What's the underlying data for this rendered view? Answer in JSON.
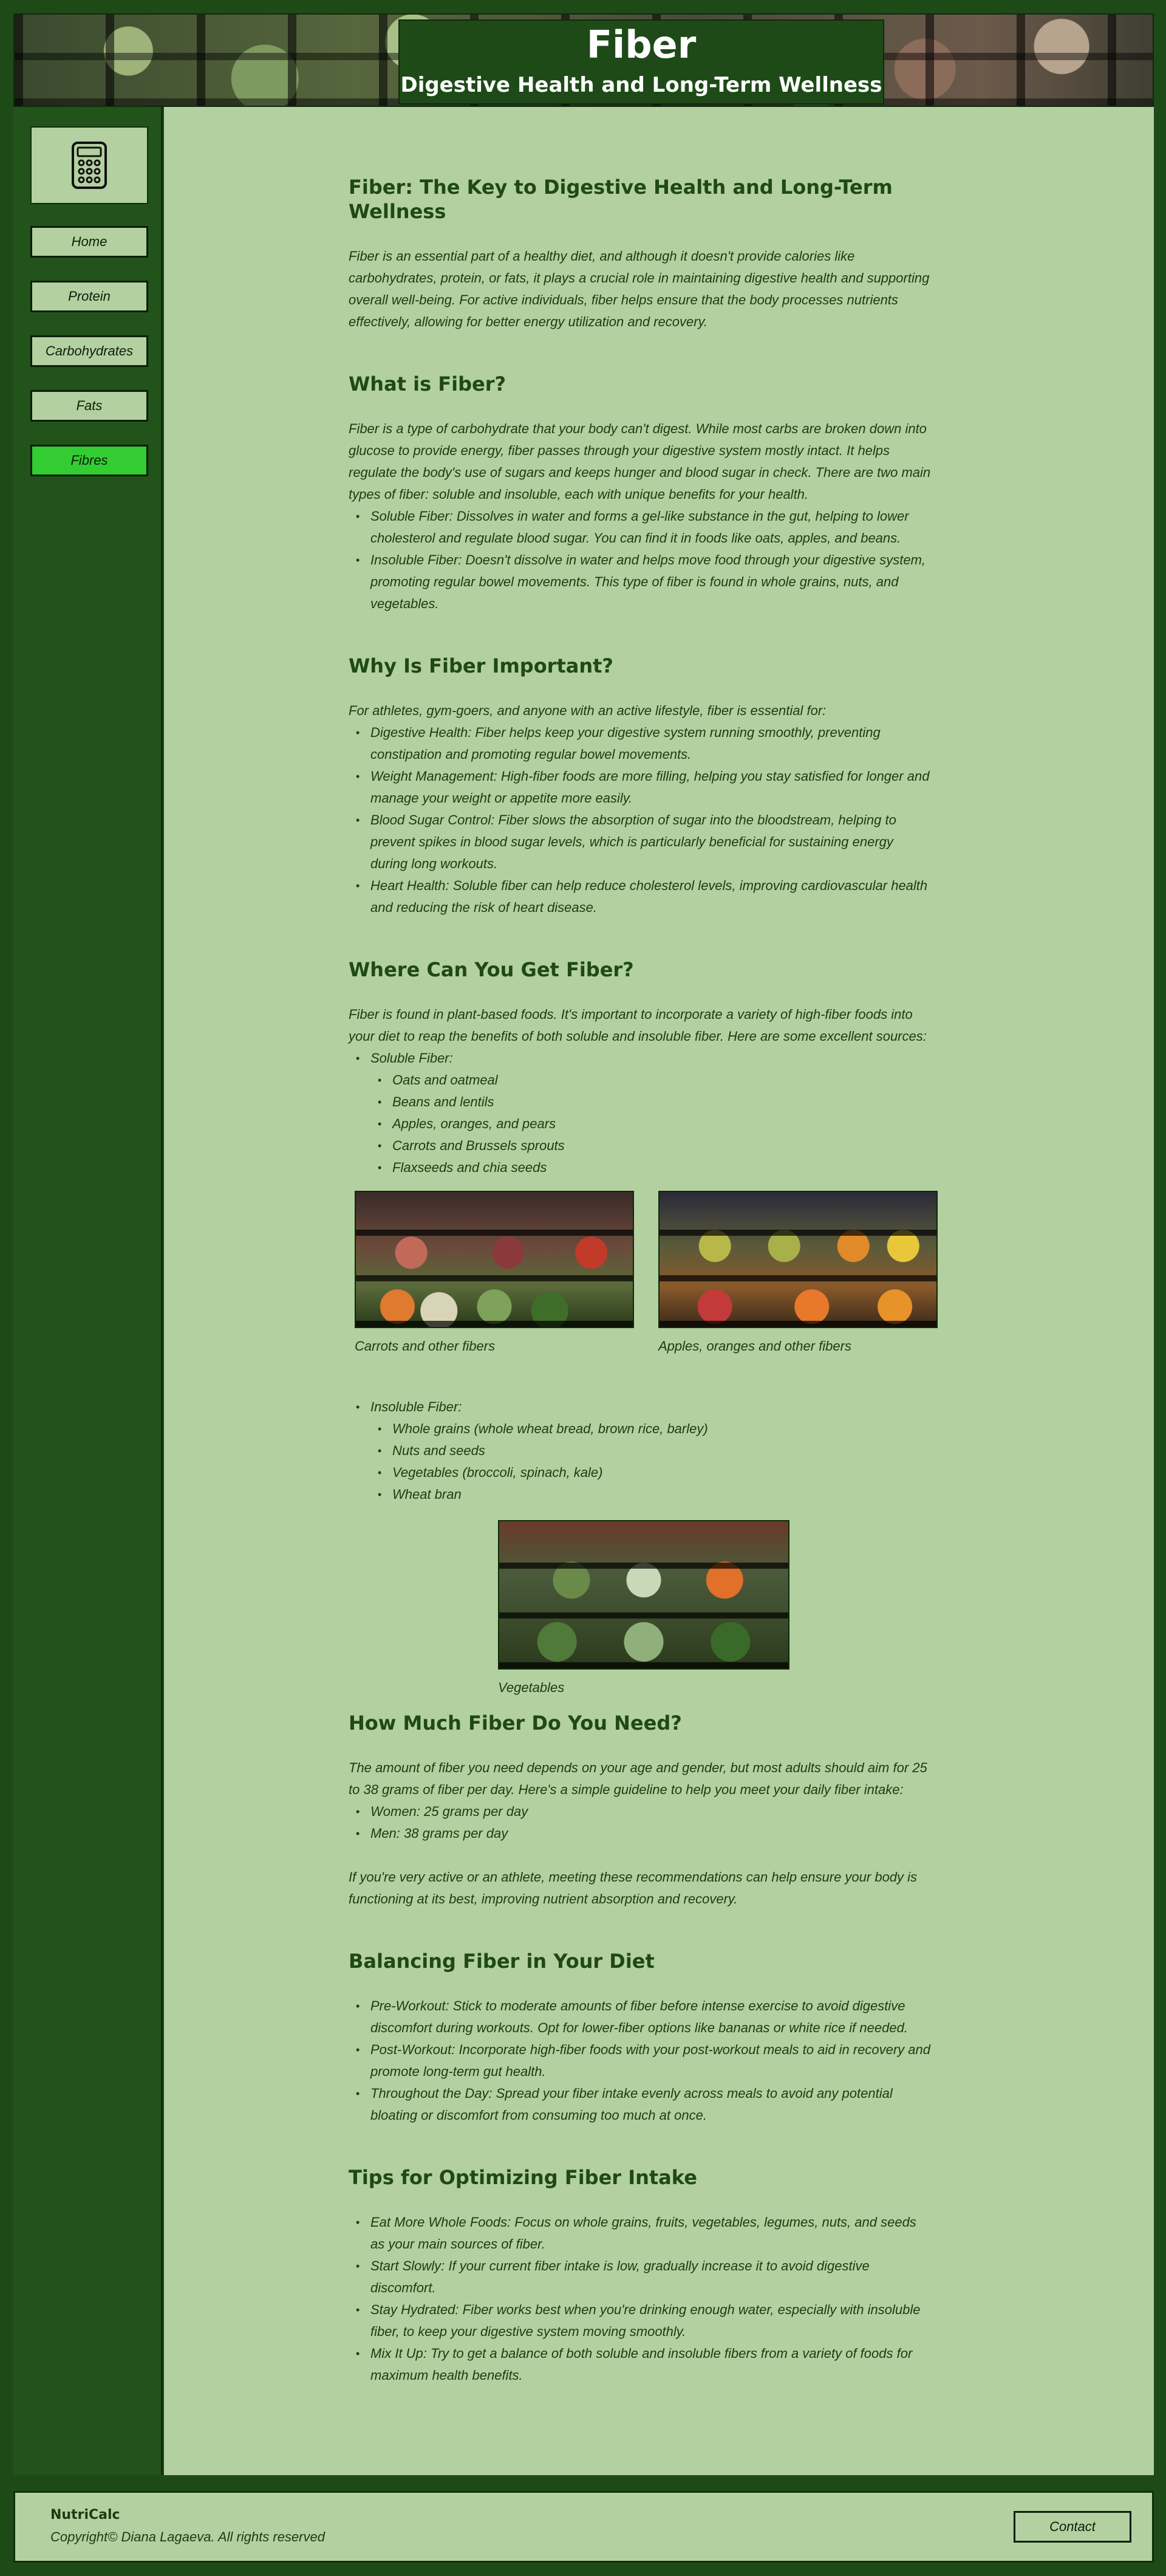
{
  "header": {
    "title": "Fiber",
    "subtitle": "Digestive Health and Long-Term Wellness"
  },
  "sidebar": {
    "logo_icon": "calculator-icon",
    "items": [
      {
        "label": "Home",
        "active": false
      },
      {
        "label": "Protein",
        "active": false
      },
      {
        "label": "Carbohydrates",
        "active": false
      },
      {
        "label": "Fats",
        "active": false
      },
      {
        "label": "Fibres",
        "active": true
      }
    ],
    "active_color": "#33cc33"
  },
  "colors": {
    "page_bg": "#1e4a18",
    "content_bg": "#b3d0a0",
    "heading": "#1f4a12"
  },
  "intro": {
    "heading": "Fiber: The Key to Digestive Health and Long-Term Wellness",
    "text": "Fiber is an essential part of a healthy diet, and although it doesn't provide calories like carbohydrates, protein, or fats, it plays a crucial role in maintaining digestive health and supporting overall well-being. For active individuals, fiber helps ensure that the body processes nutrients effectively, allowing for better energy utilization and recovery."
  },
  "what": {
    "heading": "What is Fiber?",
    "text": "Fiber is a type of carbohydrate that your body can't digest. While most carbs are broken down into glucose to provide energy, fiber passes through your digestive system mostly intact. It helps regulate the body's use of sugars and keeps hunger and blood sugar in check. There are two main types of fiber: soluble and insoluble, each with unique benefits for your health.",
    "items": [
      "Soluble Fiber: Dissolves in water and forms a gel-like substance in the gut, helping to lower cholesterol and regulate blood sugar. You can find it in foods like oats, apples, and beans.",
      "Insoluble Fiber: Doesn't dissolve in water and helps move food through your digestive system, promoting regular bowel movements. This type of fiber is found in whole grains, nuts, and vegetables."
    ]
  },
  "why": {
    "heading": "Why Is Fiber Important?",
    "text": "For athletes, gym-goers, and anyone with an active lifestyle, fiber is essential for:",
    "items": [
      "Digestive Health: Fiber helps keep your digestive system running smoothly, preventing constipation and promoting regular bowel movements.",
      "Weight Management: High-fiber foods are more filling, helping you stay satisfied for longer and manage your weight or appetite more easily.",
      "Blood Sugar Control: Fiber slows the absorption of sugar into the bloodstream, helping to prevent spikes in blood sugar levels, which is particularly beneficial for sustaining energy during long workouts.",
      "Heart Health: Soluble fiber can help reduce cholesterol levels, improving cardiovascular health and reducing the risk of heart disease."
    ]
  },
  "where": {
    "heading": "Where Can You Get Fiber?",
    "text": "Fiber is found in plant-based foods. It's important to incorporate a variety of high-fiber foods into your diet to reap the benefits of both soluble and insoluble fiber. Here are some excellent sources:",
    "soluble_label": "Soluble Fiber:",
    "soluble_items": [
      "Oats and oatmeal",
      "Beans and lentils",
      "Apples, oranges, and pears",
      "Carrots and Brussels sprouts",
      "Flaxseeds and chia seeds"
    ],
    "image1_caption": "Carrots and other fibers",
    "image2_caption": "Apples, oranges and other fibers",
    "insoluble_label": "Insoluble Fiber:",
    "insoluble_items": [
      "Whole grains (whole wheat bread, brown rice, barley)",
      "Nuts and seeds",
      "Vegetables (broccoli, spinach, kale)",
      "Wheat bran"
    ],
    "image3_caption": "Vegetables"
  },
  "how_much": {
    "heading": "How Much Fiber Do You Need?",
    "text": "The amount of fiber you need depends on your age and gender, but most adults should aim for 25 to 38 grams of fiber per day. Here's a simple guideline to help you meet your daily fiber intake:",
    "items": [
      "Women: 25 grams per day",
      "Men: 38 grams per day"
    ],
    "note": "If you're very active or an athlete, meeting these recommendations can help ensure your body is functioning at its best, improving nutrient absorption and recovery."
  },
  "balancing": {
    "heading": "Balancing Fiber in Your Diet",
    "items": [
      "Pre-Workout: Stick to moderate amounts of fiber before intense exercise to avoid digestive discomfort during workouts. Opt for lower-fiber options like bananas or white rice if needed.",
      "Post-Workout: Incorporate high-fiber foods with your post-workout meals to aid in recovery and promote long-term gut health.",
      "Throughout the Day: Spread your fiber intake evenly across meals to avoid any potential bloating or discomfort from consuming too much at once."
    ]
  },
  "tips": {
    "heading": "Tips for Optimizing Fiber Intake",
    "items": [
      "Eat More Whole Foods: Focus on whole grains, fruits, vegetables, legumes, nuts, and seeds as your main sources of fiber.",
      "Start Slowly: If your current fiber intake is low, gradually increase it to avoid digestive discomfort.",
      "Stay Hydrated: Fiber works best when you're drinking enough water, especially with insoluble fiber, to keep your digestive system moving smoothly.",
      "Mix It Up: Try to get a balance of both soluble and insoluble fibers from a variety of foods for maximum health benefits."
    ]
  },
  "footer": {
    "name": "NutriCalc",
    "copyright": "Copyright© Diana Lagaeva. All rights reserved",
    "contact_label": "Contact"
  }
}
